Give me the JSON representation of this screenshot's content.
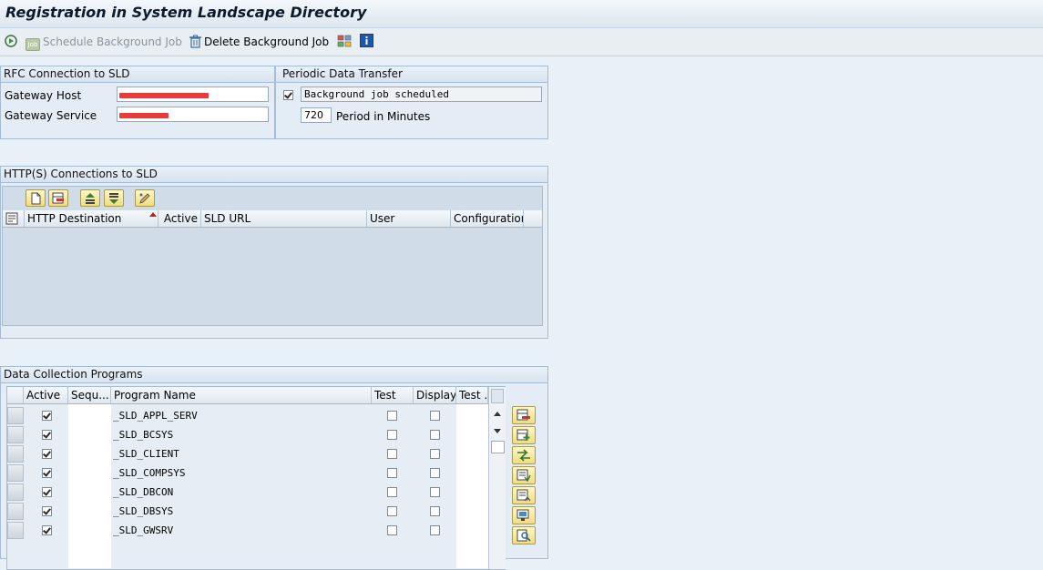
{
  "window": {
    "title": "Registration in System Landscape Directory"
  },
  "toolbar": {
    "schedule_label": "Schedule Background Job",
    "delete_label": "Delete Background Job"
  },
  "rfc": {
    "title": "RFC Connection to SLD",
    "gateway_host_label": "Gateway Host",
    "gateway_host_value": "",
    "gateway_service_label": "Gateway Service",
    "gateway_service_value": ""
  },
  "periodic": {
    "title": "Periodic Data Transfer",
    "bg_checked": true,
    "bg_text": "Background job scheduled",
    "period_value": "720",
    "period_label": "Period in Minutes"
  },
  "http": {
    "title": "HTTP(S) Connections to SLD",
    "columns": [
      "HTTP Destination",
      "Active",
      "SLD URL",
      "User",
      "Configuration"
    ]
  },
  "dcp": {
    "title": "Data Collection Programs",
    "columns": [
      "Active",
      "Sequ...",
      "Program Name",
      "Test",
      "Display",
      "Test ..."
    ],
    "rows": [
      {
        "active": true,
        "program": "_SLD_APPL_SERV",
        "test": false,
        "display": false
      },
      {
        "active": true,
        "program": "_SLD_BCSYS",
        "test": false,
        "display": false
      },
      {
        "active": true,
        "program": "_SLD_CLIENT",
        "test": false,
        "display": false
      },
      {
        "active": true,
        "program": "_SLD_COMPSYS",
        "test": false,
        "display": false
      },
      {
        "active": true,
        "program": "_SLD_DBCON",
        "test": false,
        "display": false
      },
      {
        "active": true,
        "program": "_SLD_DBSYS",
        "test": false,
        "display": false
      },
      {
        "active": true,
        "program": "_SLD_GWSRV",
        "test": false,
        "display": false
      }
    ]
  },
  "colors": {
    "accent": "#e8f0f8",
    "redaction": "#ea3a3a"
  }
}
